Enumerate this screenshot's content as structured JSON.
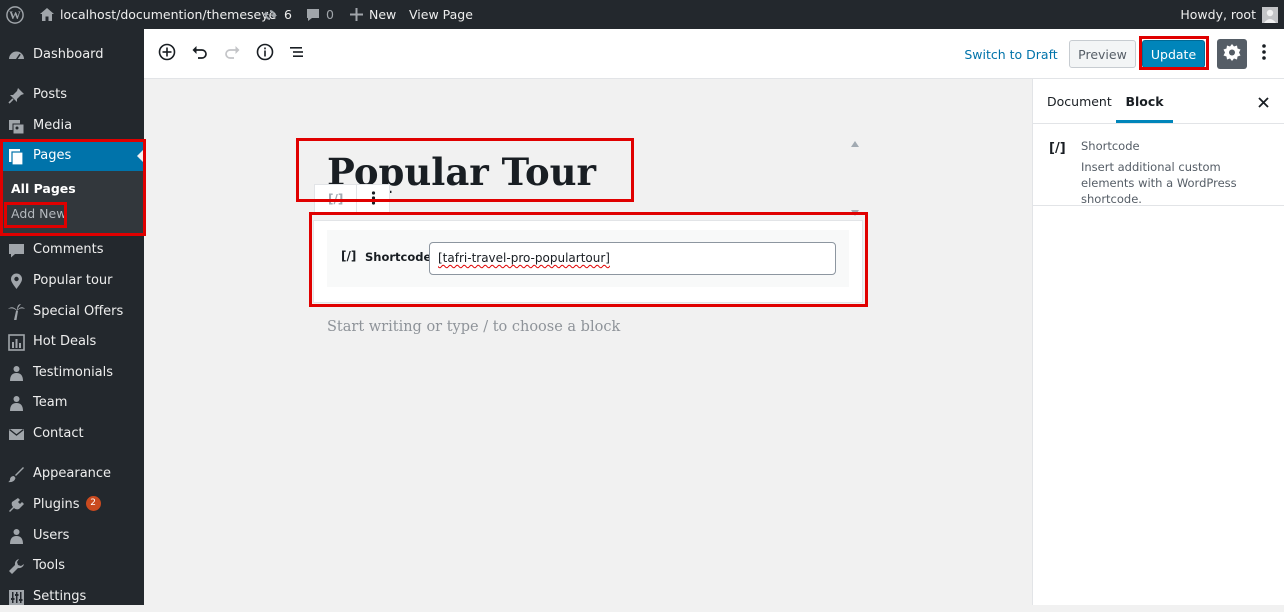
{
  "admin_bar": {
    "site_url": "localhost/documention/themeseye",
    "updates_count": "6",
    "comments_count": "0",
    "new_label": "New",
    "view_page_label": "View Page",
    "howdy": "Howdy, root"
  },
  "sidebar": {
    "items": [
      {
        "label": "Dashboard",
        "icon": "dashboard-icon"
      },
      {
        "label": "Posts",
        "icon": "pin-icon"
      },
      {
        "label": "Media",
        "icon": "media-icon"
      },
      {
        "label": "Pages",
        "icon": "pages-icon"
      },
      {
        "label": "Comments",
        "icon": "comment-icon"
      },
      {
        "label": "Popular tour",
        "icon": "location-icon"
      },
      {
        "label": "Special Offers",
        "icon": "palm-tree-icon"
      },
      {
        "label": "Hot Deals",
        "icon": "chart-icon"
      },
      {
        "label": "Testimonials",
        "icon": "users-icon"
      },
      {
        "label": "Team",
        "icon": "user-icon"
      },
      {
        "label": "Contact",
        "icon": "envelope-icon"
      },
      {
        "label": "Appearance",
        "icon": "brush-icon"
      },
      {
        "label": "Plugins",
        "icon": "plug-icon",
        "badge": "2"
      },
      {
        "label": "Users",
        "icon": "user-icon"
      },
      {
        "label": "Tools",
        "icon": "wrench-icon"
      },
      {
        "label": "Settings",
        "icon": "sliders-icon"
      }
    ],
    "pages_submenu": {
      "all_pages": "All Pages",
      "add_new": "Add New"
    }
  },
  "header": {
    "switch_to_draft": "Switch to Draft",
    "preview": "Preview",
    "update": "Update"
  },
  "editor": {
    "title": "Popular Tour",
    "block_toolbar_icon": "[/]",
    "shortcode_label": "Shortcode",
    "shortcode_icon": "[/]",
    "shortcode_value": "[tafri-travel-pro-populartour]",
    "appender_placeholder": "Start writing or type / to choose a block"
  },
  "settings_panel": {
    "tabs": [
      "Document",
      "Block"
    ],
    "active_tab": "Block",
    "block_icon": "[/]",
    "block_name": "Shortcode",
    "block_description": "Insert additional custom elements with a WordPress shortcode."
  },
  "colors": {
    "admin_dark": "#23282d",
    "wp_blue": "#0073aa",
    "update_blue": "#0085ba",
    "highlight_red": "#e00000"
  }
}
